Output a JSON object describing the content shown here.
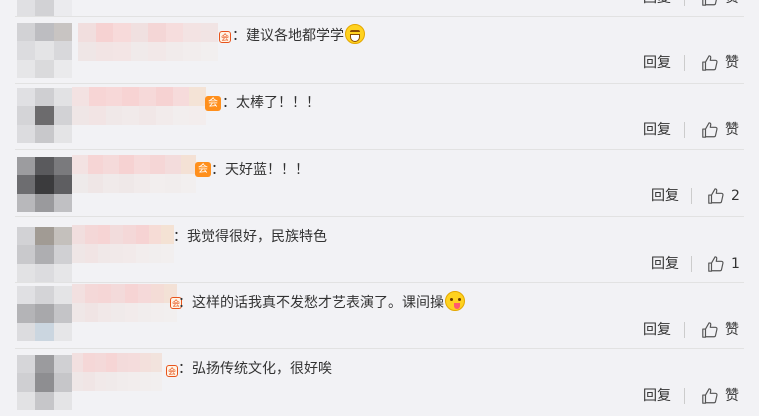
{
  "colors": {
    "background": "#f2f2f5",
    "separator": "#e2e2e2",
    "text": "#333333",
    "badge": "#ff8f1c"
  },
  "actions": {
    "reply_label": "回复"
  },
  "comments": [
    {
      "text": "：建议各地都学学",
      "emoji": "grin-emoji",
      "like_label": "赞"
    },
    {
      "text": "：太棒了！！！",
      "emoji": "",
      "like_label": "赞"
    },
    {
      "text": "：天好蓝！！！",
      "emoji": "",
      "like_label": "2"
    },
    {
      "text": "：我觉得很好，民族特色",
      "emoji": "",
      "like_label": "1"
    },
    {
      "text": "：这样的话我真不发愁才艺表演了。课间操",
      "emoji": "tongue-emoji",
      "like_label": "赞"
    },
    {
      "text": "：弘扬传统文化，很好唉",
      "emoji": "",
      "like_label": "赞"
    }
  ],
  "top_partial": {
    "reply_label": "回复",
    "like_label": "赞"
  }
}
